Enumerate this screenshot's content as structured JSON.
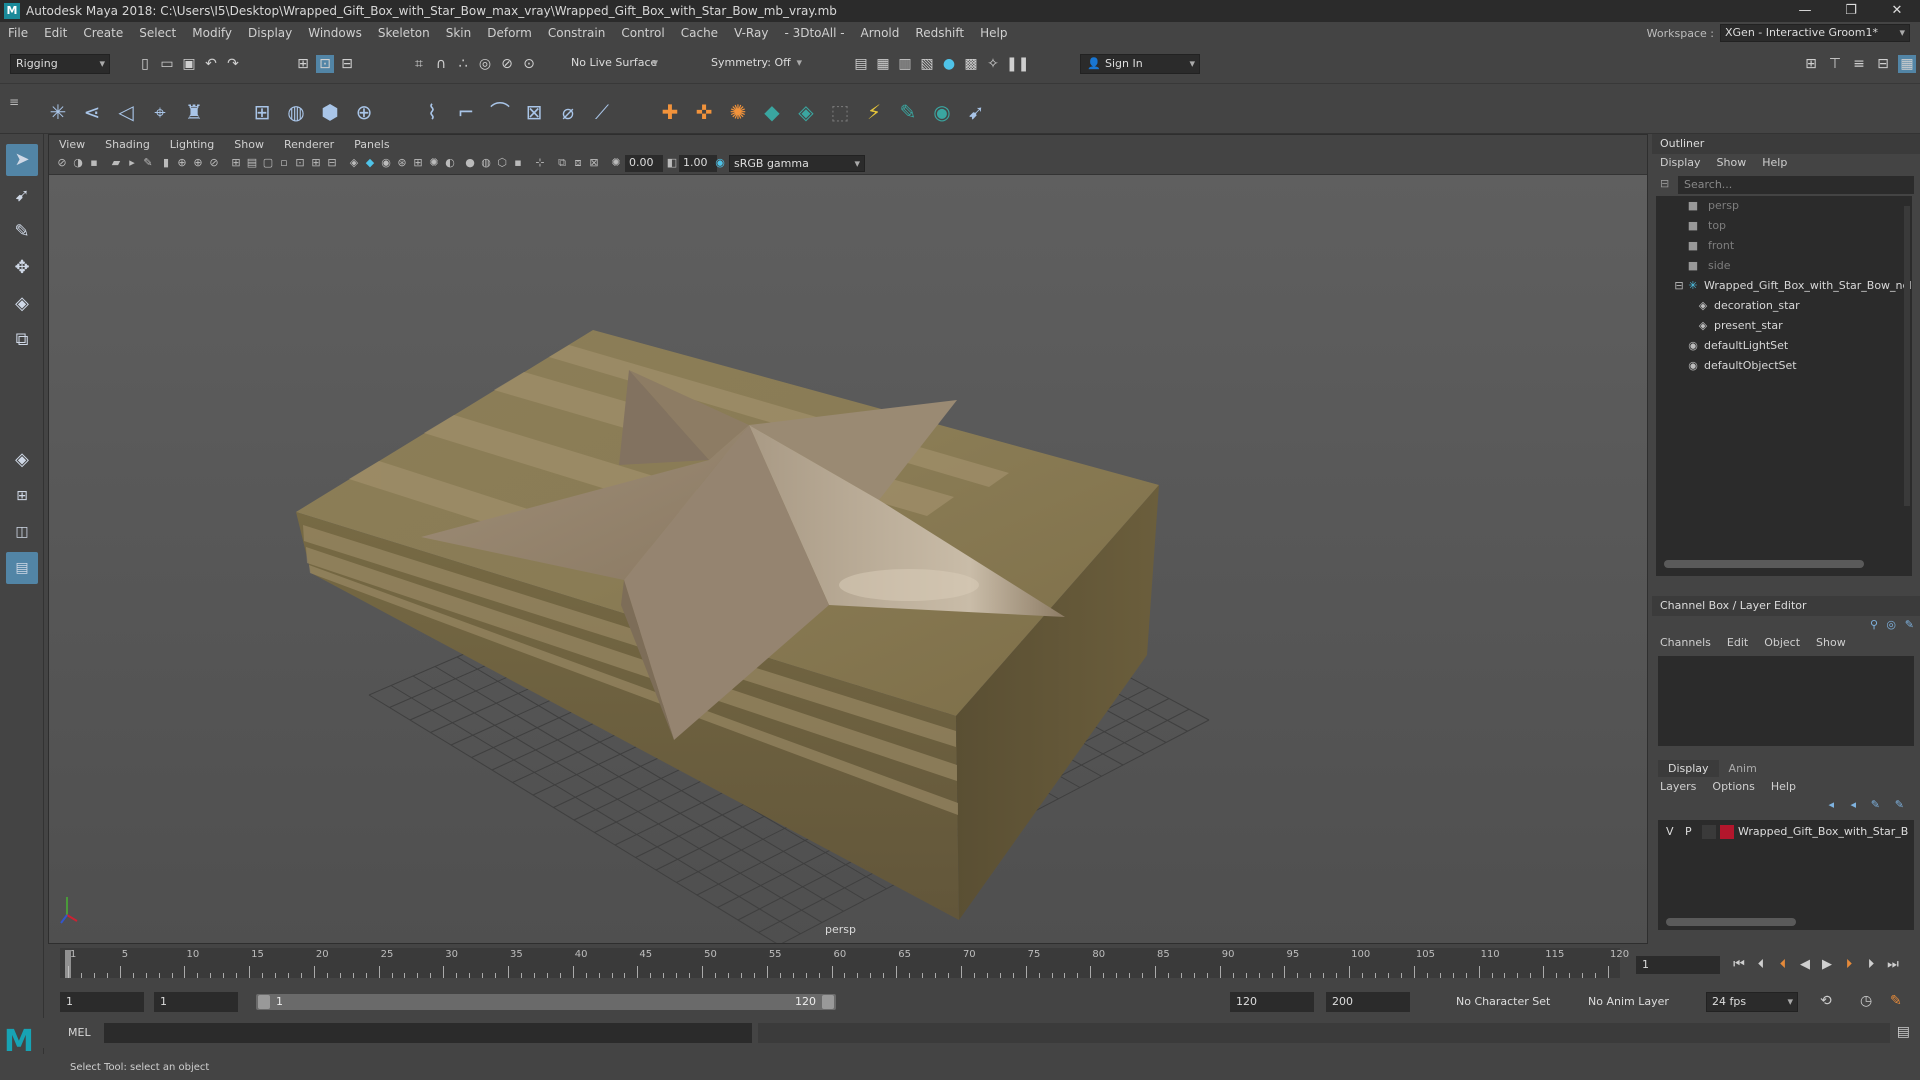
{
  "window": {
    "title": "Autodesk Maya 2018: C:\\Users\\I5\\Desktop\\Wrapped_Gift_Box_with_Star_Bow_max_vray\\Wrapped_Gift_Box_with_Star_Bow_mb_vray.mb",
    "controls": [
      "—",
      "❐",
      "✕"
    ]
  },
  "menubar": {
    "items": [
      "File",
      "Edit",
      "Create",
      "Select",
      "Modify",
      "Display",
      "Windows",
      "Skeleton",
      "Skin",
      "Deform",
      "Constrain",
      "Control",
      "Cache",
      "V-Ray",
      "- 3DtoAll -",
      "Arnold",
      "Redshift",
      "Help"
    ],
    "workspace_label": "Workspace :",
    "workspace_value": "XGen - Interactive Groom1*"
  },
  "statusline": {
    "mode": "Rigging",
    "live_surface": "No Live Surface",
    "symmetry": "Symmetry: Off",
    "sign_in": "Sign In"
  },
  "viewport": {
    "menu": [
      "View",
      "Shading",
      "Lighting",
      "Show",
      "Renderer",
      "Panels"
    ],
    "exposure": "0.00",
    "gamma": "1.00",
    "color_space": "sRGB gamma",
    "camera": "persp"
  },
  "outliner": {
    "title": "Outliner",
    "menu": [
      "Display",
      "Show",
      "Help"
    ],
    "search_placeholder": "Search...",
    "items": [
      {
        "label": "persp",
        "type": "camera",
        "dim": true
      },
      {
        "label": "top",
        "type": "camera",
        "dim": true
      },
      {
        "label": "front",
        "type": "camera",
        "dim": true
      },
      {
        "label": "side",
        "type": "camera",
        "dim": true
      },
      {
        "label": "Wrapped_Gift_Box_with_Star_Bow_ncl",
        "type": "group",
        "dim": false
      },
      {
        "label": "decoration_star",
        "type": "mesh",
        "dim": false
      },
      {
        "label": "present_star",
        "type": "mesh",
        "dim": false
      },
      {
        "label": "defaultLightSet",
        "type": "set",
        "dim": false
      },
      {
        "label": "defaultObjectSet",
        "type": "set",
        "dim": false
      }
    ]
  },
  "channelbox": {
    "title": "Channel Box / Layer Editor",
    "menu": [
      "Channels",
      "Edit",
      "Object",
      "Show"
    ]
  },
  "layereditor": {
    "tabs": [
      "Display",
      "Anim"
    ],
    "menu": [
      "Layers",
      "Options",
      "Help"
    ],
    "layer": {
      "v": "V",
      "p": "P",
      "name": "Wrapped_Gift_Box_with_Star_B",
      "color": "#b3162c"
    }
  },
  "timeslider": {
    "ticks": [
      "1",
      "5",
      "10",
      "15",
      "20",
      "25",
      "30",
      "35",
      "40",
      "45",
      "50",
      "55",
      "60",
      "65",
      "70",
      "75",
      "80",
      "85",
      "90",
      "95",
      "100",
      "105",
      "110",
      "115",
      "120"
    ],
    "current_frame": "1"
  },
  "rangebar": {
    "start": "1",
    "playback_start": "1",
    "slider_start": "1",
    "slider_end": "120",
    "playback_end": "120",
    "end": "200",
    "character_set": "No Character Set",
    "anim_layer": "No Anim Layer",
    "fps": "24 fps"
  },
  "commandline": {
    "label": "MEL"
  },
  "helpline": {
    "text": "Select Tool: select an object"
  },
  "colors": {
    "accent": "#5285a6",
    "box": "#8a7c52",
    "star": "#a3927a"
  }
}
